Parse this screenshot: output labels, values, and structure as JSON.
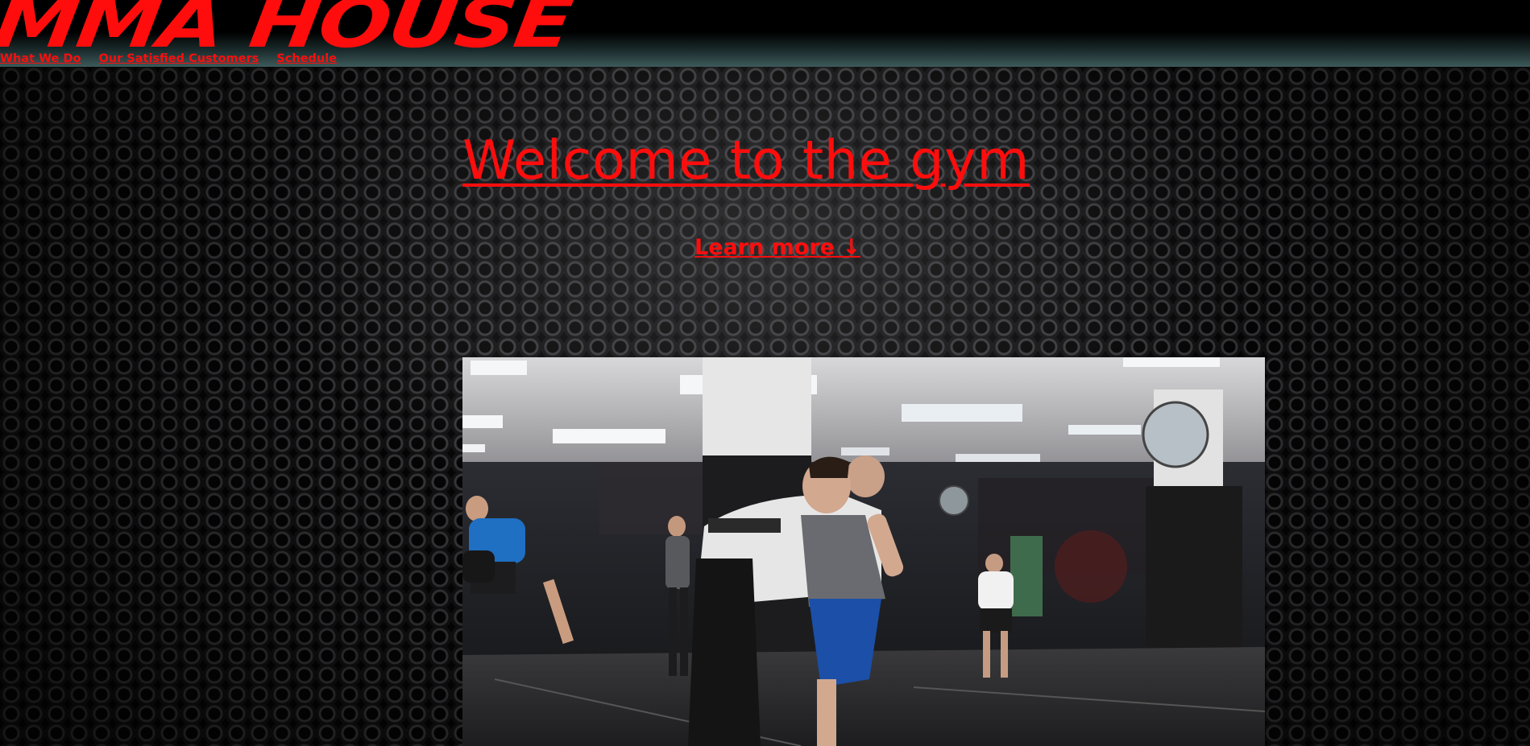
{
  "header": {
    "logo_text": "MMA HOUSE",
    "nav": [
      {
        "label": "What We Do"
      },
      {
        "label": "Our Satisfied Customers"
      },
      {
        "label": "Schedule"
      }
    ]
  },
  "hero": {
    "title": "Welcome to the gym",
    "learn_more": "Learn more ↓",
    "image_alt": "gym training photo"
  },
  "colors": {
    "accent": "#ff0d0d",
    "background": "#0b0b0b"
  }
}
